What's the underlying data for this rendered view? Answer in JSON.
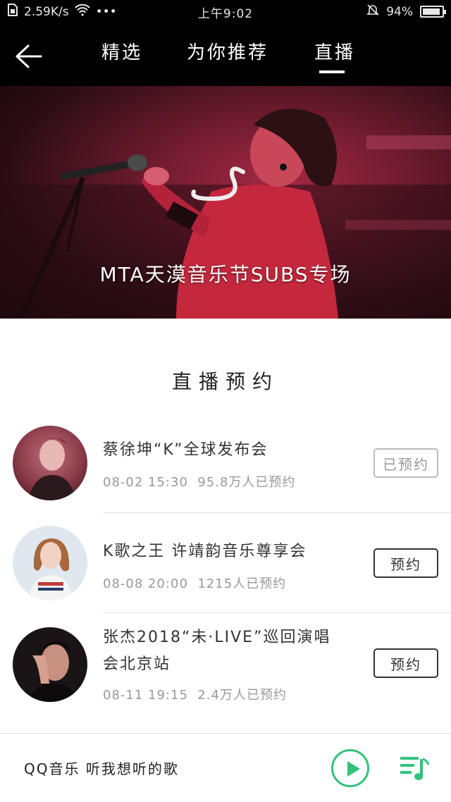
{
  "status_bar": {
    "speed": "2.59K/s",
    "dots": "•••",
    "time": "上午9:02",
    "battery_text": "94%",
    "battery_level": 0.94
  },
  "header": {
    "tabs": [
      {
        "label": "精选",
        "active": false
      },
      {
        "label": "为你推荐",
        "active": false
      },
      {
        "label": "直播",
        "active": true
      }
    ]
  },
  "banner": {
    "title": "MTA天漠音乐节SUBS专场"
  },
  "section": {
    "title": "直播预约"
  },
  "live_items": [
    {
      "title": "蔡徐坤“K”全球发布会",
      "date": "08-02 15:30",
      "count": "95.8万人已预约",
      "button": "已预约",
      "reserved": true
    },
    {
      "title": "K歌之王 许靖韵音乐尊享会",
      "date": "08-08 20:00",
      "count": "1215人已预约",
      "button": "预约",
      "reserved": false
    },
    {
      "title_line1": "张杰2018“未·LIVE”巡回演唱",
      "title_line2": "会北京站",
      "date": "08-11 19:15",
      "count": "2.4万人已预约",
      "button": "预约",
      "reserved": false
    }
  ],
  "player": {
    "text": "QQ音乐 听我想听的歌",
    "accent": "#31c27c"
  }
}
